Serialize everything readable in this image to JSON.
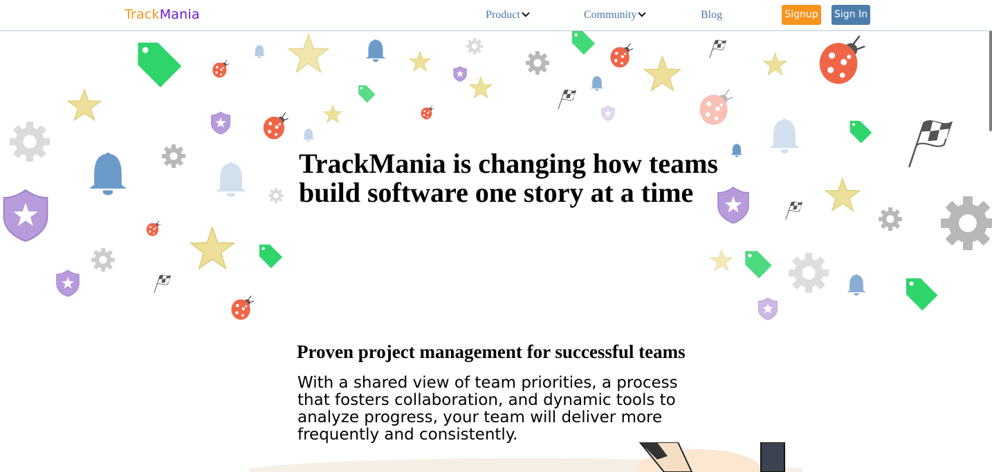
{
  "nav": {
    "logo_part1": "Track",
    "logo_part2": "Mania",
    "product_label": "Product",
    "community_label": "Community",
    "blog_label": "Blog",
    "signup_label": "Signup",
    "signin_label": "Sign In"
  },
  "hero": {
    "headline": "TrackMania is changing how teams build software one story at a time"
  },
  "section": {
    "subheading": "Proven project management for successful teams",
    "body": "With a shared view of team priorities, a process that fosters collaboration, and dynamic tools to analyze progress, your team will deliver more frequently and consistently."
  },
  "colors": {
    "logo_track": "#f7941d",
    "logo_mania": "#6a16d6",
    "link": "#4679a8",
    "signup_bg": "#f7941d",
    "signin_bg": "#4e7fab",
    "star": "#ede09a",
    "bell": "#6d9bc9",
    "tag": "#2fd46a",
    "ladybug": "#f06548",
    "shield": "#b89bdb",
    "gear": "#b8b8b8",
    "flag": "#555555"
  },
  "decor_icons": [
    "star-icon",
    "bell-icon",
    "tag-icon",
    "ladybug-icon",
    "shield-icon",
    "gear-icon",
    "checkered-flag-icon"
  ]
}
